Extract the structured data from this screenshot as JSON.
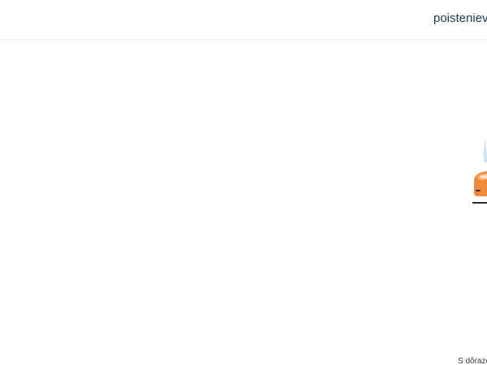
{
  "header": {
    "site_name": "poisteniev"
  },
  "illustration": {
    "icon": "car-insurance-illustration-icon",
    "colors": {
      "orange": "#f08a3a",
      "light_blue": "#cfe3f5",
      "dark": "#2a2a2a"
    }
  },
  "footer": {
    "text": "S dôrazo"
  }
}
